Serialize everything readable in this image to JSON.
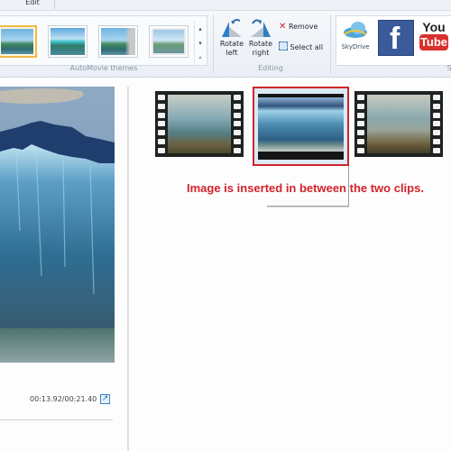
{
  "ribbon": {
    "tabs": [
      {
        "label": "Edit"
      }
    ],
    "groups": {
      "automovie_themes": {
        "label": "AutoMovie themes",
        "theme_count": 4,
        "selected_index": 0
      },
      "editing": {
        "label": "Editing",
        "rotate_left": {
          "line1": "Rotate",
          "line2": "left"
        },
        "rotate_right": {
          "line1": "Rotate",
          "line2": "right"
        },
        "remove": "Remove",
        "select_all": "Select all"
      },
      "share": {
        "label": "S",
        "skydrive": "SkyDrive",
        "facebook": "f",
        "youtube_top": "You",
        "youtube_bottom": "Tube"
      }
    }
  },
  "preview": {
    "time": "00:13.92/00:21.40",
    "expand_icon": "expand-arrow-icon"
  },
  "storyboard": {
    "items": [
      {
        "type": "video",
        "name": "clip-1"
      },
      {
        "type": "image",
        "name": "inserted-image",
        "highlighted": true
      },
      {
        "type": "video",
        "name": "clip-2"
      }
    ],
    "highlight_color": "#d2232a"
  },
  "annotation": {
    "text": "Image is inserted in between the two clips."
  }
}
